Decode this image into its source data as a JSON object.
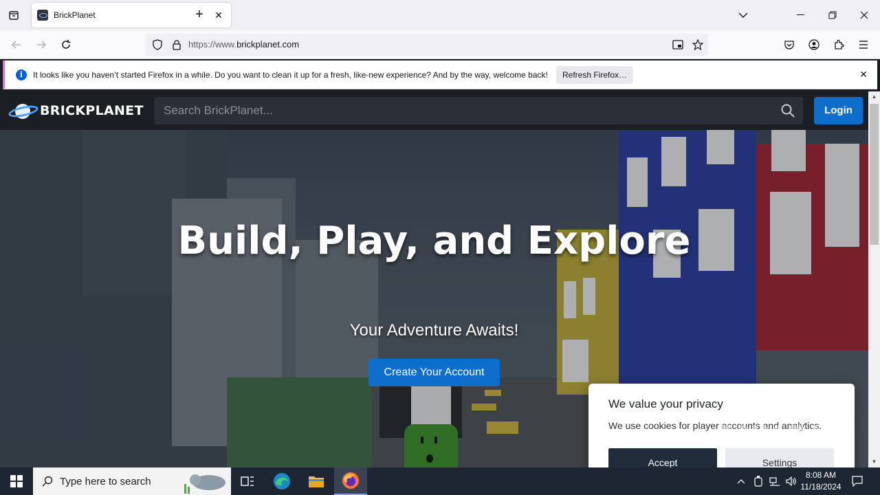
{
  "browser": {
    "tab_title": "BrickPlanet",
    "url_prefix": "https://www.",
    "url_domain": "brickplanet.com",
    "notification": {
      "message": "It looks like you haven’t started Firefox in a while. Do you want to clean it up for a fresh, like-new experience? And by the way, welcome back!",
      "button": "Refresh Firefox…"
    }
  },
  "site": {
    "logo_text": "BRICKPLANET",
    "search_placeholder": "Search BrickPlanet...",
    "login_label": "Login",
    "hero": {
      "title": "Build, Play, and Explore",
      "subtitle": "Your Adventure Awaits!",
      "cta": "Create Your Account"
    },
    "cookie": {
      "title": "We value your privacy",
      "description": "We use cookies for player accounts and analytics.",
      "accept": "Accept",
      "settings": "Settings"
    }
  },
  "watermark": "ANY.RUN",
  "taskbar": {
    "search_placeholder": "Type here to search",
    "time": "8:08 AM",
    "date": "11/18/2024"
  },
  "colors": {
    "accent": "#0d6ecb",
    "nav_bg": "#1b1f24",
    "cookie_accept": "#1f2d3a"
  }
}
